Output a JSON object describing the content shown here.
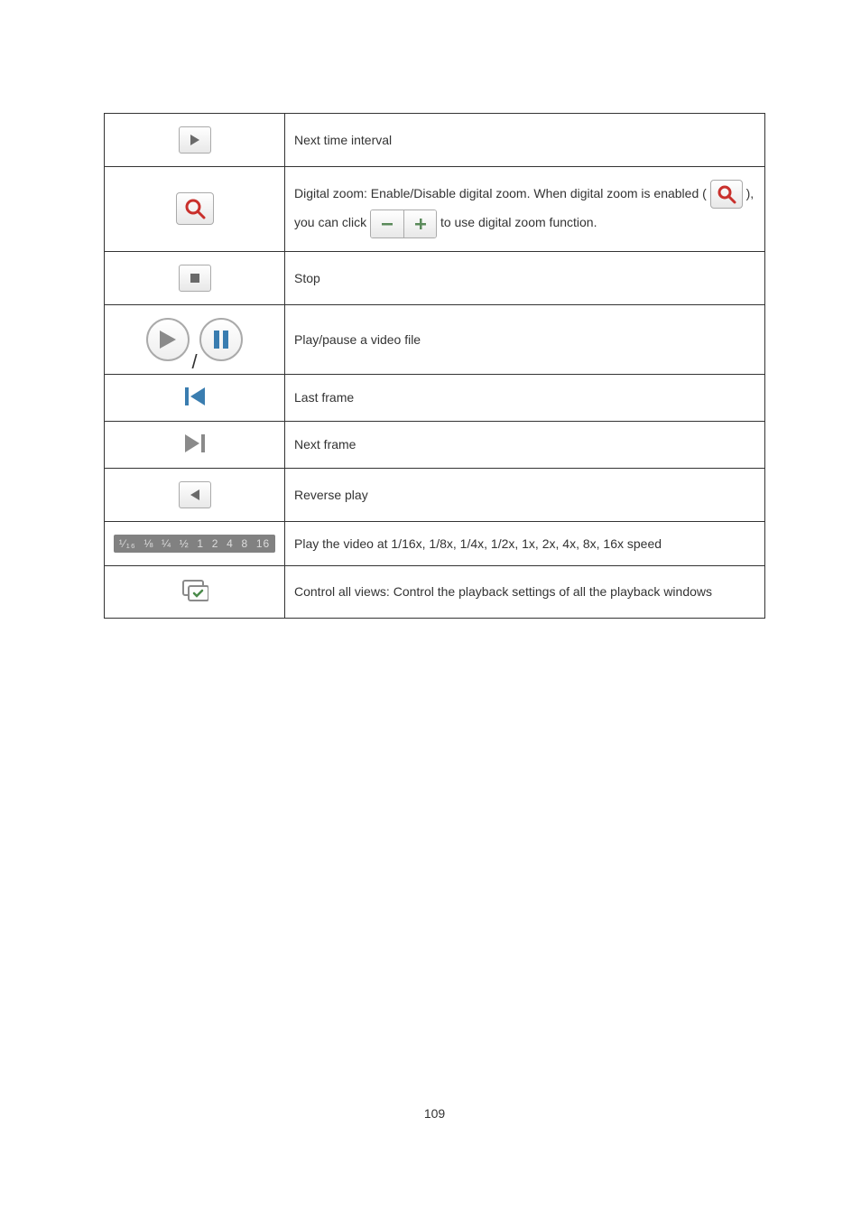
{
  "rows": {
    "next_interval": "Next time interval",
    "digital_zoom_pre": "Digital zoom: Enable/Disable digital zoom.   When digital zoom is enabled (",
    "digital_zoom_mid": "), you can click ",
    "digital_zoom_post": " to use digital zoom function.",
    "stop": "Stop",
    "play_pause": "Play/pause a video file",
    "last_frame": "Last frame",
    "next_frame": "Next frame",
    "reverse_play": "Reverse play",
    "speed": "Play the video at 1/16x, 1/8x, 1/4x, 1/2x, 1x, 2x, 4x, 8x, 16x speed",
    "control_all": "Control all views: Control the playback settings of all the playback windows"
  },
  "speed_labels": [
    "¹⁄₁₆",
    "⅛",
    "¼",
    "½",
    "1",
    "2",
    "4",
    "8",
    "16"
  ],
  "page_number": "109"
}
